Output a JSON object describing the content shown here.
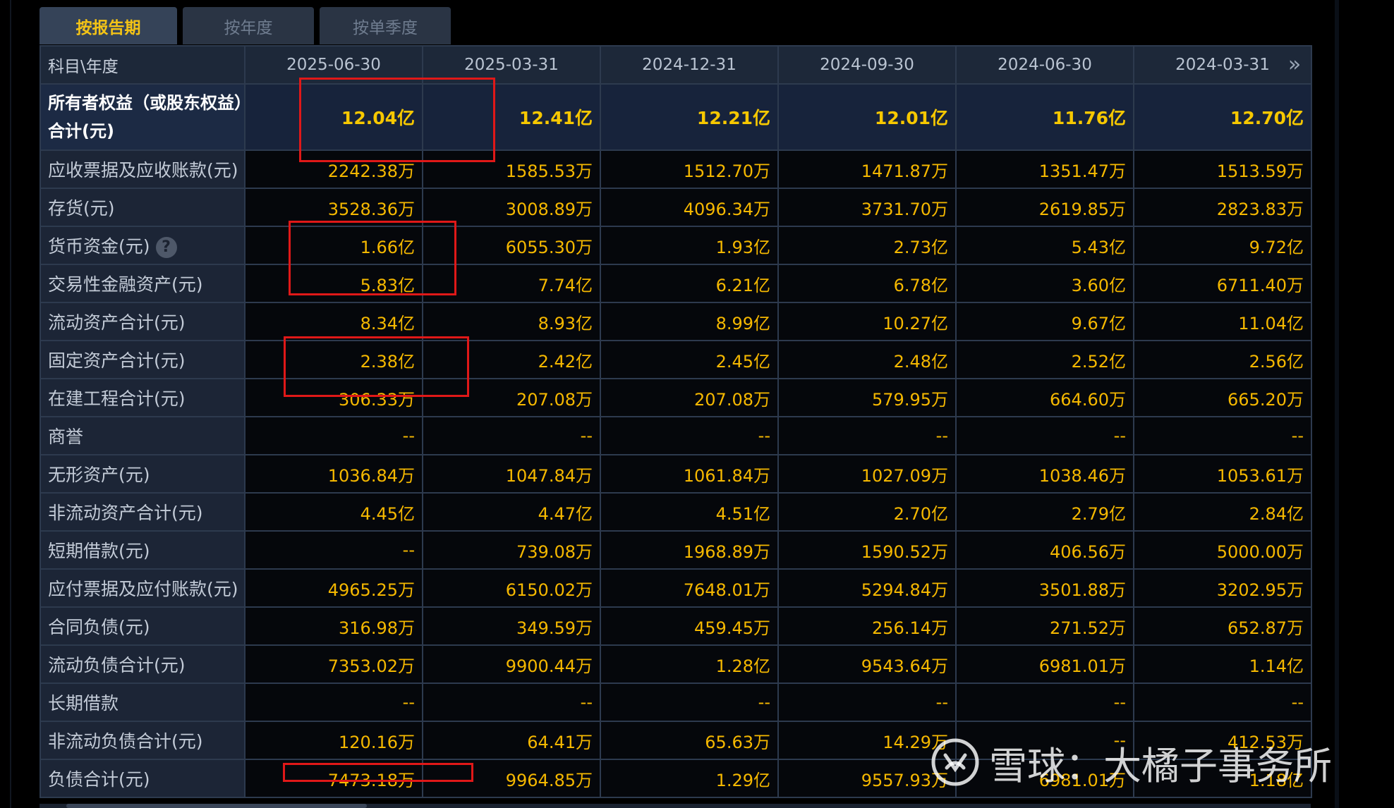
{
  "tabs": [
    {
      "label": "按报告期",
      "active": true
    },
    {
      "label": "按年度",
      "active": false
    },
    {
      "label": "按单季度",
      "active": false
    }
  ],
  "table": {
    "corner_label": "科目\\年度",
    "columns": [
      "2025-06-30",
      "2025-03-31",
      "2024-12-31",
      "2024-09-30",
      "2024-06-30",
      "2024-03-31"
    ],
    "rows": [
      {
        "label": "所有者权益（或股东权益）合计(元)",
        "values": [
          "12.04亿",
          "12.41亿",
          "12.21亿",
          "12.01亿",
          "11.76亿",
          "12.70亿"
        ]
      },
      {
        "label": "应收票据及应收账款(元)",
        "values": [
          "2242.38万",
          "1585.53万",
          "1512.70万",
          "1471.87万",
          "1351.47万",
          "1513.59万"
        ]
      },
      {
        "label": "存货(元)",
        "values": [
          "3528.36万",
          "3008.89万",
          "4096.34万",
          "3731.70万",
          "2619.85万",
          "2823.83万"
        ]
      },
      {
        "label": "货币资金(元)",
        "values": [
          "1.66亿",
          "6055.30万",
          "1.93亿",
          "2.73亿",
          "5.43亿",
          "9.72亿"
        ]
      },
      {
        "label": "交易性金融资产(元)",
        "values": [
          "5.83亿",
          "7.74亿",
          "6.21亿",
          "6.78亿",
          "3.60亿",
          "6711.40万"
        ]
      },
      {
        "label": "流动资产合计(元)",
        "values": [
          "8.34亿",
          "8.93亿",
          "8.99亿",
          "10.27亿",
          "9.67亿",
          "11.04亿"
        ]
      },
      {
        "label": "固定资产合计(元)",
        "values": [
          "2.38亿",
          "2.42亿",
          "2.45亿",
          "2.48亿",
          "2.52亿",
          "2.56亿"
        ]
      },
      {
        "label": "在建工程合计(元)",
        "values": [
          "306.33万",
          "207.08万",
          "207.08万",
          "579.95万",
          "664.60万",
          "665.20万"
        ]
      },
      {
        "label": "商誉",
        "values": [
          "--",
          "--",
          "--",
          "--",
          "--",
          "--"
        ]
      },
      {
        "label": "无形资产(元)",
        "values": [
          "1036.84万",
          "1047.84万",
          "1061.84万",
          "1027.09万",
          "1038.46万",
          "1053.61万"
        ]
      },
      {
        "label": "非流动资产合计(元)",
        "values": [
          "4.45亿",
          "4.47亿",
          "4.51亿",
          "2.70亿",
          "2.79亿",
          "2.84亿"
        ]
      },
      {
        "label": "短期借款(元)",
        "values": [
          "--",
          "739.08万",
          "1968.89万",
          "1590.52万",
          "406.56万",
          "5000.00万"
        ]
      },
      {
        "label": "应付票据及应付账款(元)",
        "values": [
          "4965.25万",
          "6150.02万",
          "7648.01万",
          "5294.84万",
          "3501.88万",
          "3202.95万"
        ]
      },
      {
        "label": "合同负债(元)",
        "values": [
          "316.98万",
          "349.59万",
          "459.45万",
          "256.14万",
          "271.52万",
          "652.87万"
        ]
      },
      {
        "label": "流动负债合计(元)",
        "values": [
          "7353.02万",
          "9900.44万",
          "1.28亿",
          "9543.64万",
          "6981.01万",
          "1.14亿"
        ]
      },
      {
        "label": "长期借款",
        "values": [
          "--",
          "--",
          "--",
          "--",
          "--",
          "--"
        ]
      },
      {
        "label": "非流动负债合计(元)",
        "values": [
          "120.16万",
          "64.41万",
          "65.63万",
          "14.29万",
          "--",
          "412.53万"
        ]
      },
      {
        "label": "负债合计(元)",
        "values": [
          "7473.18万",
          "9964.85万",
          "1.29亿",
          "9557.93万",
          "6981.01万",
          "1.18亿"
        ]
      }
    ]
  },
  "watermark": {
    "text": "雪球：大橘子事务所"
  },
  "icons": {
    "next": "double-chevron-right-icon",
    "help": "question-circle-icon",
    "watermark_logo": "snowball-logo-icon"
  },
  "colors": {
    "value": "#f5b800",
    "highlight_box": "#e01818",
    "active_tab_text": "#f3c316"
  }
}
